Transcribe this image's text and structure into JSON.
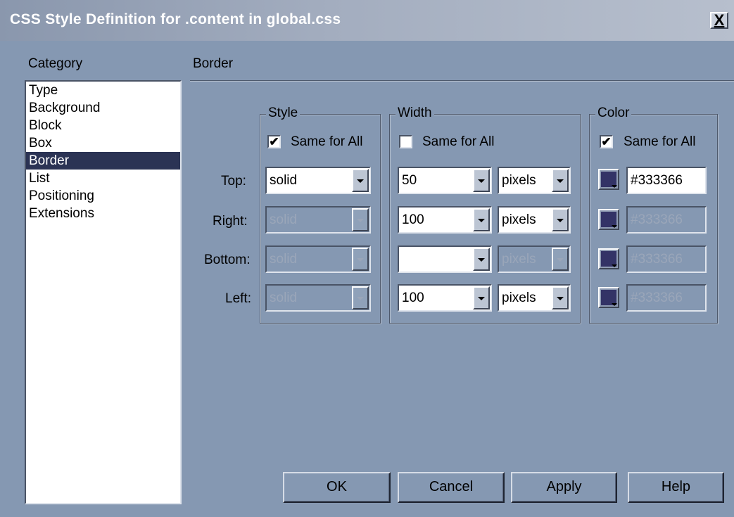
{
  "window": {
    "title": "CSS Style Definition for .content in global.css",
    "close_label": "X"
  },
  "category": {
    "label": "Category",
    "items": [
      {
        "label": "Type",
        "selected": false
      },
      {
        "label": "Background",
        "selected": false
      },
      {
        "label": "Block",
        "selected": false
      },
      {
        "label": "Box",
        "selected": false
      },
      {
        "label": "Border",
        "selected": true
      },
      {
        "label": "List",
        "selected": false
      },
      {
        "label": "Positioning",
        "selected": false
      },
      {
        "label": "Extensions",
        "selected": false
      }
    ]
  },
  "panel": {
    "title": "Border"
  },
  "style_group": {
    "label": "Style",
    "same_for_all": {
      "label": "Same for All",
      "checked": true
    },
    "values": {
      "top": "solid",
      "right": "solid",
      "bottom": "solid",
      "left": "solid"
    }
  },
  "width_group": {
    "label": "Width",
    "same_for_all": {
      "label": "Same for All",
      "checked": false
    },
    "values": {
      "top": "50",
      "right": "100",
      "bottom": "",
      "left": "100"
    },
    "units": {
      "top": "pixels",
      "right": "pixels",
      "bottom": "pixels",
      "left": "pixels"
    }
  },
  "color_group": {
    "label": "Color",
    "same_for_all": {
      "label": "Same for All",
      "checked": true
    },
    "values": {
      "top": "#333366",
      "right": "#333366",
      "bottom": "#333366",
      "left": "#333366"
    },
    "swatch_color": "#333366"
  },
  "rows": {
    "top": "Top:",
    "right": "Right:",
    "bottom": "Bottom:",
    "left": "Left:"
  },
  "buttons": {
    "ok": "OK",
    "cancel": "Cancel",
    "apply": "Apply",
    "help": "Help"
  }
}
